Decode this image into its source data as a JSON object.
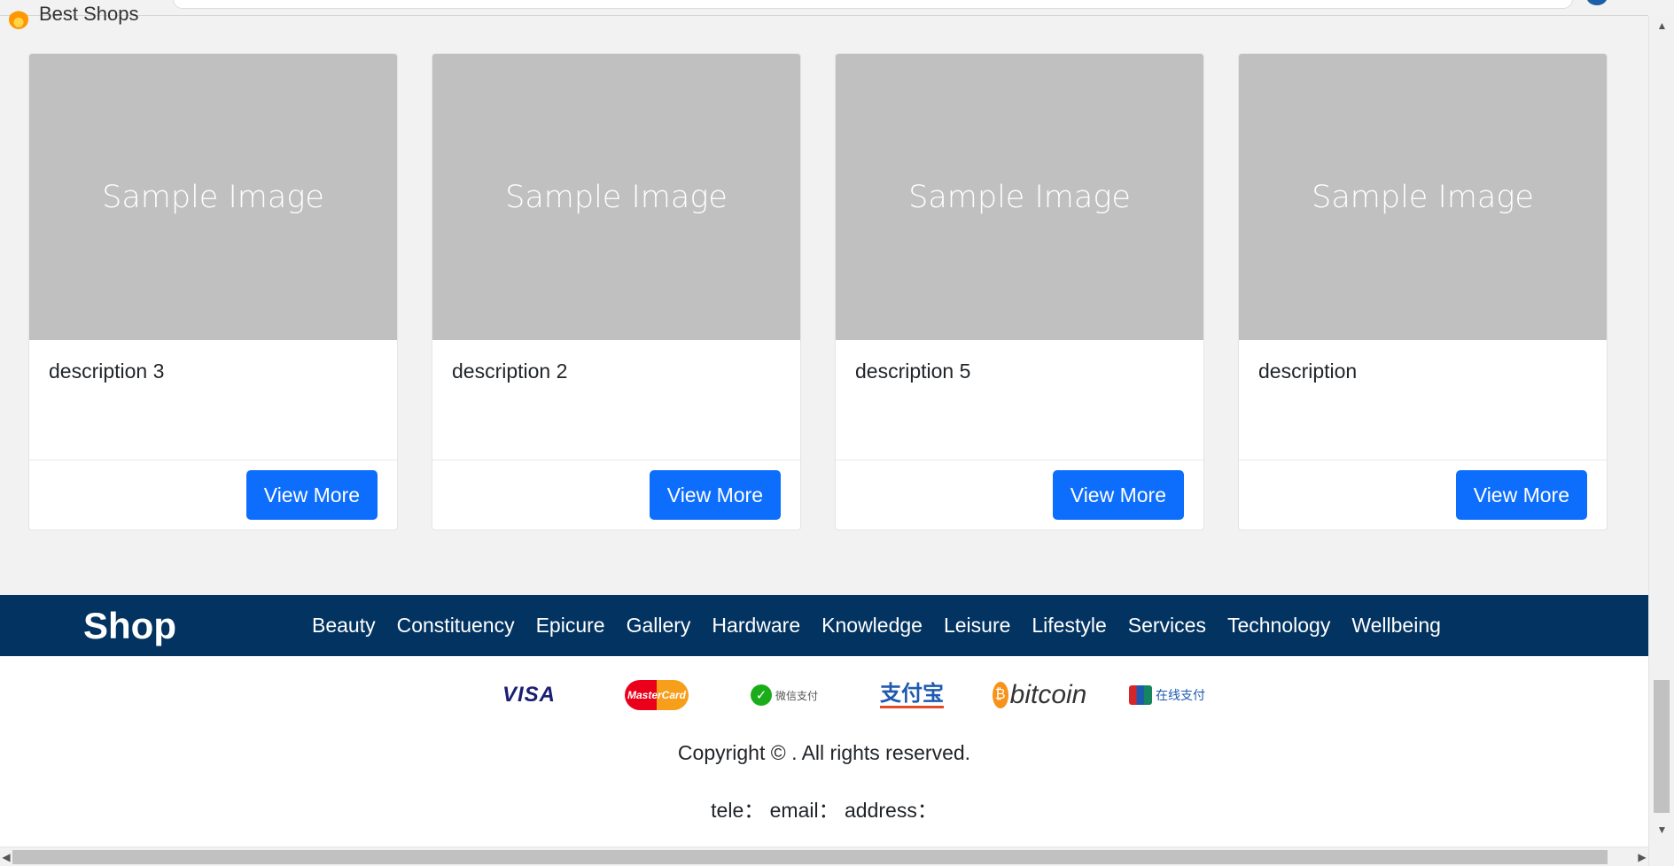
{
  "section": {
    "title": "Best Shops"
  },
  "cards": [
    {
      "image_text": "Sample Image",
      "description": "description 3",
      "button": "View More"
    },
    {
      "image_text": "Sample Image",
      "description": "description 2",
      "button": "View More"
    },
    {
      "image_text": "Sample Image",
      "description": "description 5",
      "button": "View More"
    },
    {
      "image_text": "Sample Image",
      "description": "description",
      "button": "View More"
    }
  ],
  "footer": {
    "brand": "Shop",
    "nav": [
      "Beauty",
      "Constituency",
      "Epicure",
      "Gallery",
      "Hardware",
      "Knowledge",
      "Leisure",
      "Lifestyle",
      "Services",
      "Technology",
      "Wellbeing"
    ],
    "payments": {
      "visa": "VISA",
      "mastercard": "MasterCard",
      "wechat": "微信支付",
      "alipay": "支付宝",
      "bitcoin": "bitcoin",
      "unionpay": "在线支付"
    },
    "copyright": "Copyright © . All rights reserved.",
    "contact": "tele： email： address："
  },
  "colors": {
    "accent": "#0d6efd",
    "footer_bg": "#023361",
    "placeholder_bg": "#c0c0c0",
    "page_bg": "#f2f2f2"
  }
}
